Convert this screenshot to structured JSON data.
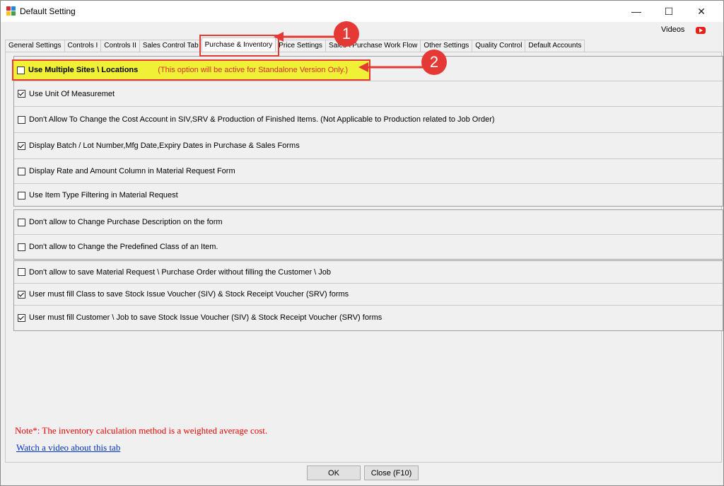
{
  "window": {
    "title": "Default Setting",
    "controls": {
      "minimize": "—",
      "maximize": "☐",
      "close": "✕"
    }
  },
  "header": {
    "videos_label": "Videos"
  },
  "tabs": [
    {
      "label": "General Settings"
    },
    {
      "label": "Controls I"
    },
    {
      "label": "Controls II"
    },
    {
      "label": "Sales Control Tab"
    },
    {
      "label": "Purchase & Inventory",
      "active": true
    },
    {
      "label": "Price Settings"
    },
    {
      "label": "Sales \\ Purchase Work Flow"
    },
    {
      "label": "Other Settings"
    },
    {
      "label": "Quality Control"
    },
    {
      "label": "Default Accounts"
    }
  ],
  "group1": {
    "highlighted": {
      "label": "Use Multiple Sites \\ Locations",
      "note": "(This option will be active for Standalone Version Only.)",
      "checked": false
    },
    "rows": [
      {
        "label": "Use Unit Of Measuremet",
        "checked": true
      },
      {
        "label": "Don't Allow To Change the Cost Account in SIV,SRV & Production of Finished Items. (Not Applicable to Production related to Job Order)",
        "checked": false
      },
      {
        "label": "Display Batch / Lot Number,Mfg Date,Expiry Dates in Purchase & Sales Forms",
        "checked": true
      },
      {
        "label": "Display Rate and Amount Column in Material Request Form",
        "checked": false
      },
      {
        "label": "Use Item Type Filtering in Material Request",
        "checked": false
      }
    ]
  },
  "group2": {
    "rows": [
      {
        "label": "Don't allow to Change Purchase Description  on the form",
        "checked": false
      },
      {
        "label": "Don't allow to Change the Predefined Class of an Item.",
        "checked": false
      }
    ]
  },
  "group3": {
    "rows": [
      {
        "label": "Don't allow to save Material Request \\ Purchase Order without filling the Customer \\ Job",
        "checked": false
      },
      {
        "label": "User must fill Class to save Stock Issue Voucher (SIV) & Stock Receipt Voucher (SRV) forms",
        "checked": true
      },
      {
        "label": "User must fill Customer \\ Job to save Stock Issue Voucher (SIV) & Stock Receipt Voucher (SRV) forms",
        "checked": true
      }
    ]
  },
  "footer": {
    "note": "Note*: The inventory calculation method is a weighted average cost.",
    "video_link": "Watch a video about this tab",
    "ok_label": "OK",
    "close_label": "Close (F10)"
  },
  "annotations": {
    "badge1": "1",
    "badge2": "2",
    "color": "#e53935"
  }
}
